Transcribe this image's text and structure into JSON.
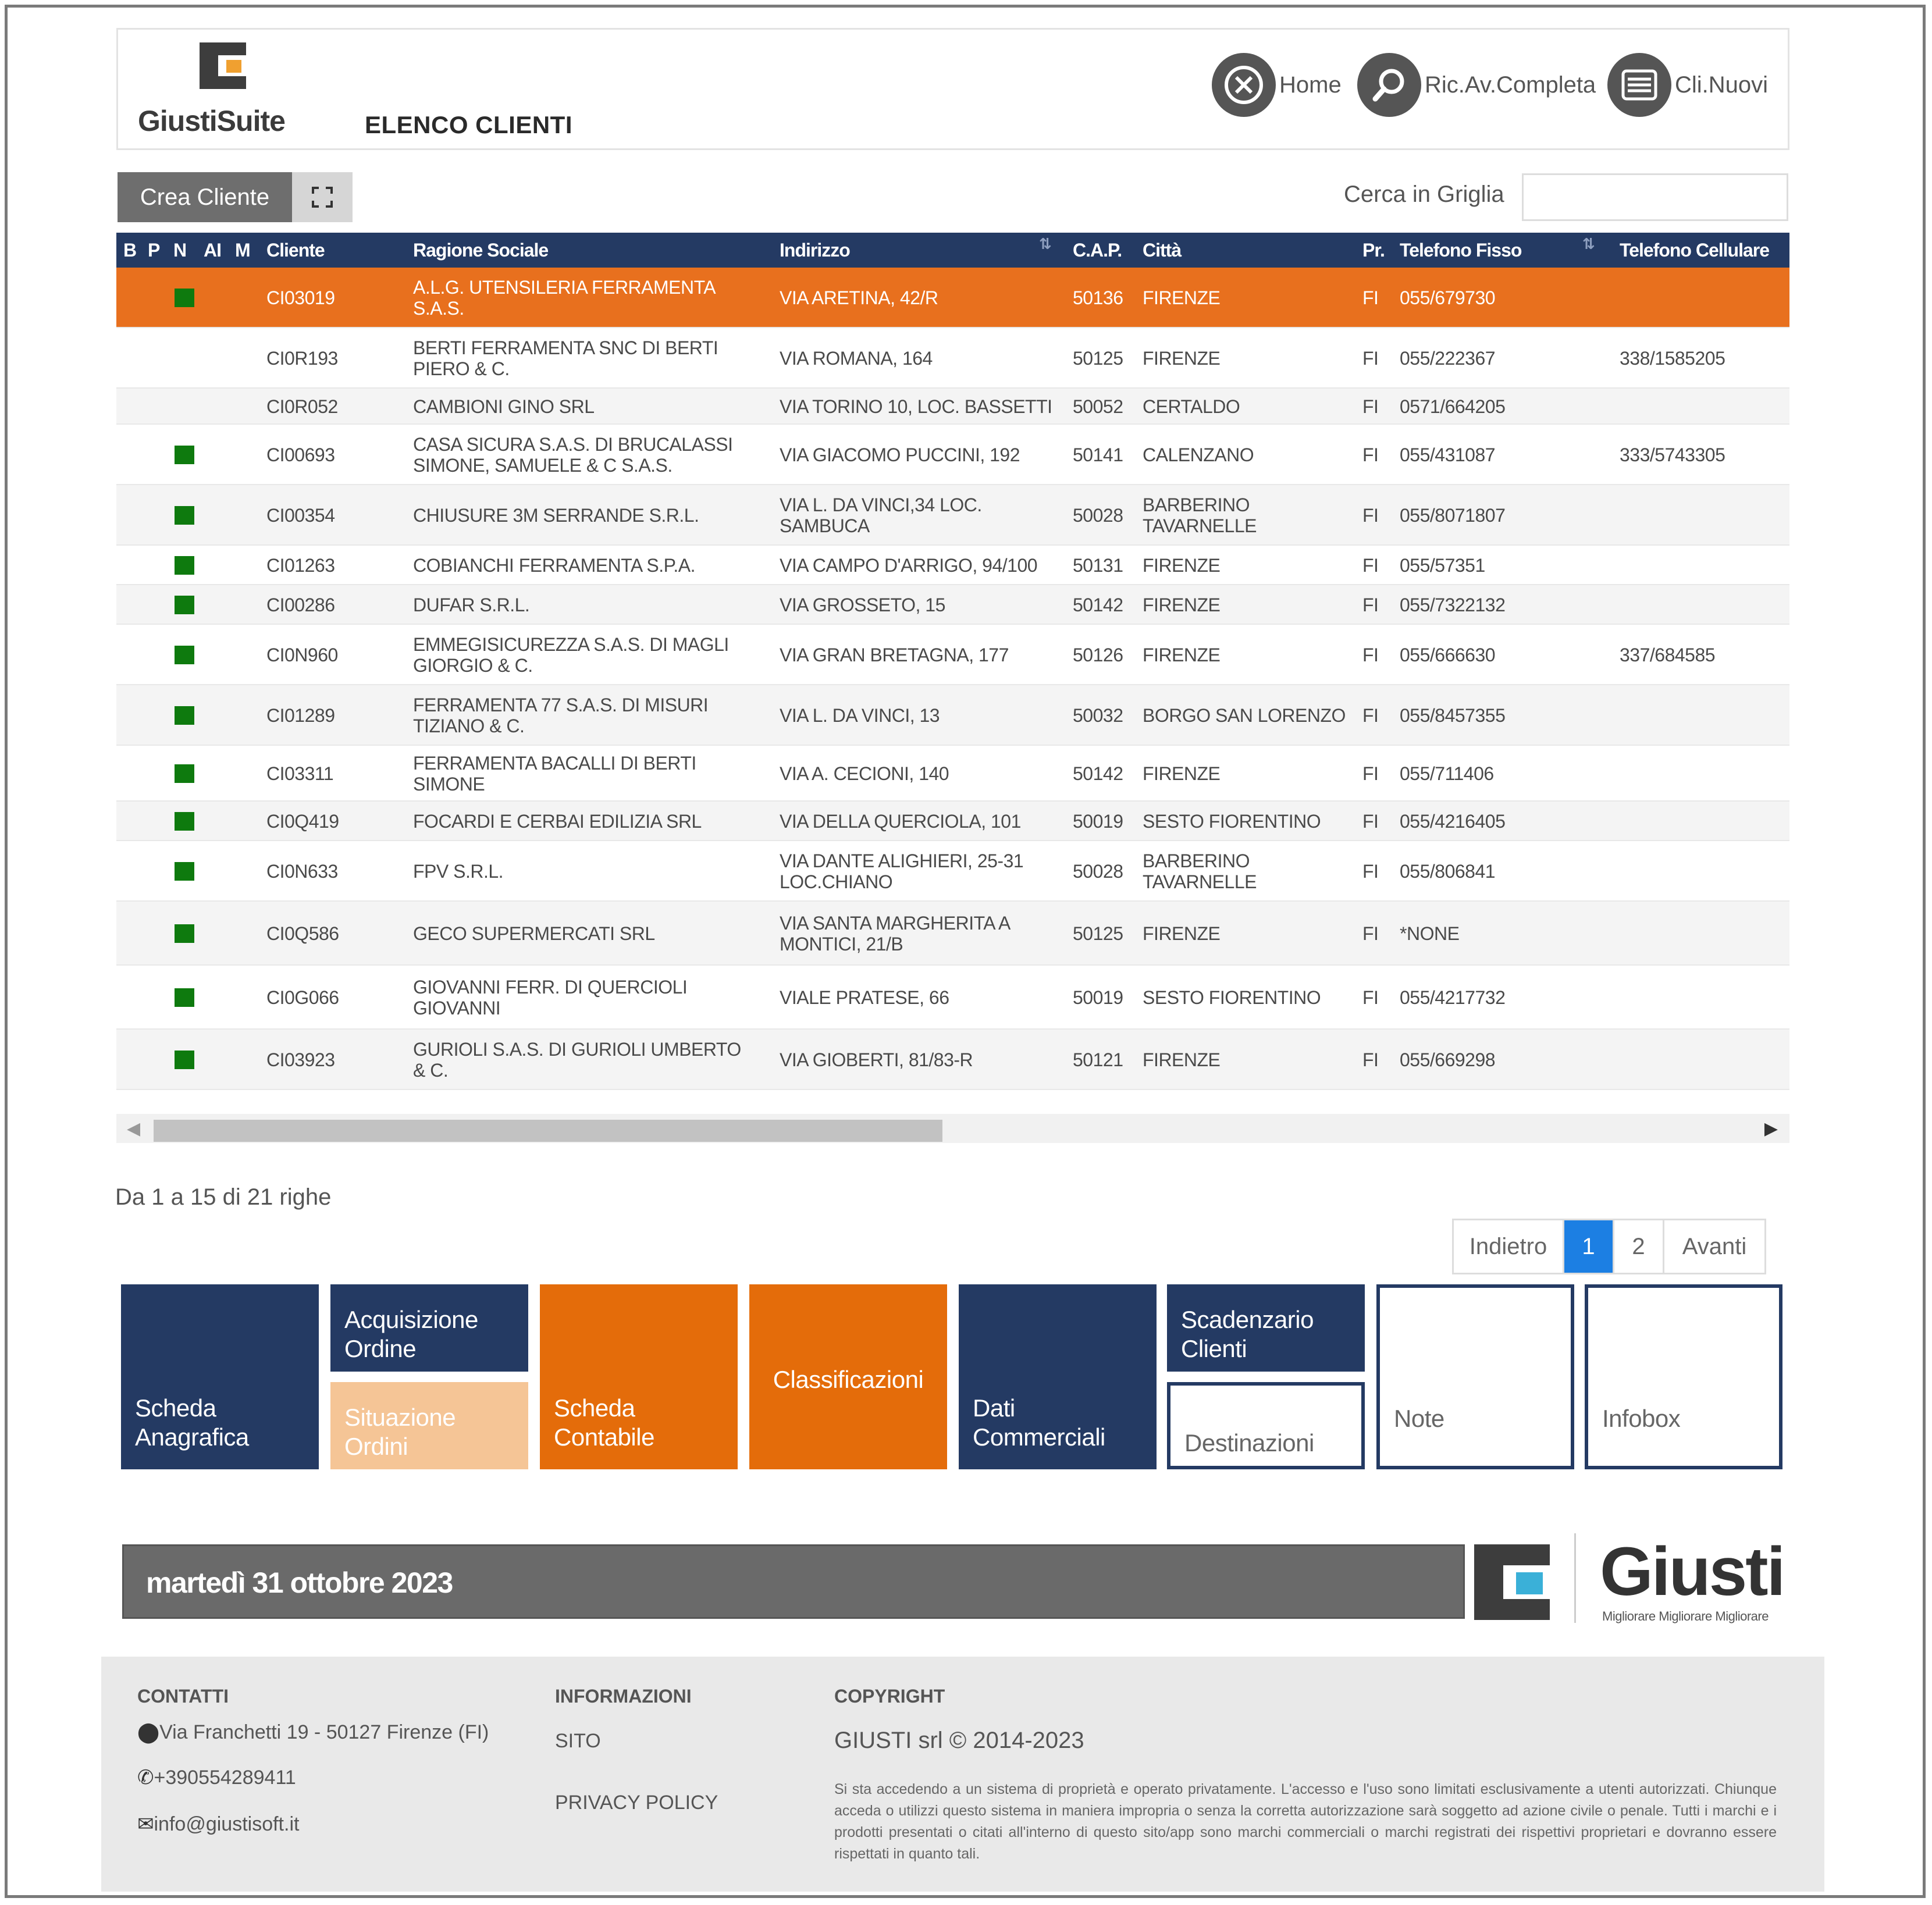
{
  "header": {
    "brand": "GiustiSuite",
    "page_title": "ELENCO CLIENTI",
    "nav": [
      {
        "label": "Home",
        "icon": "close-circle-icon"
      },
      {
        "label": "Ric.Av.Completa",
        "icon": "search-icon"
      },
      {
        "label": "Cli.Nuovi",
        "icon": "list-icon"
      }
    ]
  },
  "toolbar": {
    "create_label": "Crea Cliente",
    "expand_icon": "expand-icon",
    "search_label": "Cerca in Griglia",
    "search_value": ""
  },
  "table": {
    "columns": [
      "B",
      "P",
      "N",
      "AI",
      "M",
      "Cliente",
      "Ragione Sociale",
      "Indirizzo",
      "C.A.P.",
      "Città",
      "Pr.",
      "Telefono Fisso",
      "Telefono Cellulare"
    ],
    "rows": [
      {
        "flag": true,
        "cliente": "CI03019",
        "ragione": "A.L.G. UTENSILERIA FERRAMENTA S.A.S.",
        "indirizzo": "VIA ARETINA, 42/R",
        "cap": "50136",
        "citta": "FIRENZE",
        "pr": "FI",
        "fisso": "055/679730",
        "cell": ""
      },
      {
        "flag": false,
        "cliente": "CI0R193",
        "ragione": "BERTI FERRAMENTA SNC DI BERTI PIERO & C.",
        "indirizzo": "VIA ROMANA, 164",
        "cap": "50125",
        "citta": "FIRENZE",
        "pr": "FI",
        "fisso": "055/222367",
        "cell": "338/1585205"
      },
      {
        "flag": false,
        "cliente": "CI0R052",
        "ragione": "CAMBIONI GINO SRL",
        "indirizzo": "VIA TORINO 10, LOC. BASSETTI",
        "cap": "50052",
        "citta": "CERTALDO",
        "pr": "FI",
        "fisso": "0571/664205",
        "cell": ""
      },
      {
        "flag": true,
        "cliente": "CI00693",
        "ragione": "CASA SICURA S.A.S. DI BRUCALASSI SIMONE, SAMUELE & C S.A.S.",
        "indirizzo": "VIA GIACOMO PUCCINI, 192",
        "cap": "50141",
        "citta": "CALENZANO",
        "pr": "FI",
        "fisso": "055/431087",
        "cell": "333/5743305"
      },
      {
        "flag": true,
        "cliente": "CI00354",
        "ragione": "CHIUSURE 3M SERRANDE S.R.L.",
        "indirizzo": "VIA L. DA VINCI,34 LOC. SAMBUCA",
        "cap": "50028",
        "citta": "BARBERINO TAVARNELLE",
        "pr": "FI",
        "fisso": "055/8071807",
        "cell": ""
      },
      {
        "flag": true,
        "cliente": "CI01263",
        "ragione": "COBIANCHI FERRAMENTA S.P.A.",
        "indirizzo": "VIA CAMPO D'ARRIGO, 94/100",
        "cap": "50131",
        "citta": "FIRENZE",
        "pr": "FI",
        "fisso": "055/57351",
        "cell": ""
      },
      {
        "flag": true,
        "cliente": "CI00286",
        "ragione": "DUFAR S.R.L.",
        "indirizzo": "VIA GROSSETO, 15",
        "cap": "50142",
        "citta": "FIRENZE",
        "pr": "FI",
        "fisso": "055/7322132",
        "cell": ""
      },
      {
        "flag": true,
        "cliente": "CI0N960",
        "ragione": "EMMEGISICUREZZA S.A.S. DI MAGLI GIORGIO & C.",
        "indirizzo": "VIA GRAN BRETAGNA, 177",
        "cap": "50126",
        "citta": "FIRENZE",
        "pr": "FI",
        "fisso": "055/666630",
        "cell": "337/684585"
      },
      {
        "flag": true,
        "cliente": "CI01289",
        "ragione": "FERRAMENTA 77 S.A.S. DI MISURI TIZIANO & C.",
        "indirizzo": "VIA L. DA VINCI, 13",
        "cap": "50032",
        "citta": "BORGO SAN LORENZO",
        "pr": "FI",
        "fisso": "055/8457355",
        "cell": ""
      },
      {
        "flag": true,
        "cliente": "CI03311",
        "ragione": "FERRAMENTA BACALLI DI BERTI SIMONE",
        "indirizzo": "VIA A. CECIONI, 140",
        "cap": "50142",
        "citta": "FIRENZE",
        "pr": "FI",
        "fisso": "055/711406",
        "cell": ""
      },
      {
        "flag": true,
        "cliente": "CI0Q419",
        "ragione": "FOCARDI E CERBAI EDILIZIA SRL",
        "indirizzo": "VIA DELLA QUERCIOLA, 101",
        "cap": "50019",
        "citta": "SESTO FIORENTINO",
        "pr": "FI",
        "fisso": "055/4216405",
        "cell": ""
      },
      {
        "flag": true,
        "cliente": "CI0N633",
        "ragione": "FPV S.R.L.",
        "indirizzo": "VIA DANTE ALIGHIERI, 25-31 LOC.CHIANO",
        "cap": "50028",
        "citta": "BARBERINO TAVARNELLE",
        "pr": "FI",
        "fisso": "055/806841",
        "cell": ""
      },
      {
        "flag": true,
        "cliente": "CI0Q586",
        "ragione": "GECO SUPERMERCATI SRL",
        "indirizzo": "VIA SANTA MARGHERITA A MONTICI, 21/B",
        "cap": "50125",
        "citta": "FIRENZE",
        "pr": "FI",
        "fisso": "*NONE",
        "cell": ""
      },
      {
        "flag": true,
        "cliente": "CI0G066",
        "ragione": "GIOVANNI FERR. DI QUERCIOLI GIOVANNI",
        "indirizzo": "VIALE PRATESE, 66",
        "cap": "50019",
        "citta": "SESTO FIORENTINO",
        "pr": "FI",
        "fisso": "055/4217732",
        "cell": ""
      },
      {
        "flag": true,
        "cliente": "CI03923",
        "ragione": "GURIOLI S.A.S. DI GURIOLI UMBERTO & C.",
        "indirizzo": "VIA GIOBERTI, 81/83-R",
        "cap": "50121",
        "citta": "FIRENZE",
        "pr": "FI",
        "fisso": "055/669298",
        "cell": ""
      }
    ]
  },
  "pagination": {
    "info": "Da 1 a 15 di 21 righe",
    "prev": "Indietro",
    "pages": [
      "1",
      "2"
    ],
    "active_page": "1",
    "next": "Avanti"
  },
  "tiles": {
    "scheda_anagrafica": "Scheda Anagrafica",
    "acquisizione_ordine": "Acquisizione Ordine",
    "situazione_ordini": "Situazione Ordini",
    "scheda_contabile": "Scheda Contabile",
    "classificazioni": "Classificazioni",
    "dati_commerciali": "Dati Commerciali",
    "scadenzario_clienti": "Scadenzario Clienti",
    "destinazioni": "Destinazioni",
    "note": "Note",
    "infobox": "Infobox"
  },
  "datebar": {
    "date": "martedì 31 ottobre 2023"
  },
  "brand_footer": {
    "word": "Giusti",
    "tagline": "Migliorare Migliorare Migliorare"
  },
  "footer": {
    "contatti_title": "CONTATTI",
    "address": "Via Franchetti 19 - 50127 Firenze (FI)",
    "phone": "+390554289411",
    "email": "info@giustisoft.it",
    "info_title": "INFORMAZIONI",
    "sito": "SITO",
    "privacy": "PRIVACY POLICY",
    "copyright_title": "COPYRIGHT",
    "copyright": "GIUSTI srl © 2014-2023",
    "disclaimer": "Si sta accedendo a un sistema di proprietà e operato privatamente. L'accesso e l'uso sono limitati esclusivamente a utenti autorizzati. Chiunque acceda o utilizzi questo sistema in maniera impropria o senza la corretta autorizzazione sarà soggetto ad azione civile o penale. Tutti i marchi e i prodotti presentati o citati all'interno di questo sito/app sono marchi commerciali o marchi registrati dei rispettivi proprietari e dovranno essere rispettati in quanto tali."
  },
  "colors": {
    "navy": "#243a63",
    "orange": "#e46c0a",
    "selected_row": "#e8701e",
    "flag_green": "#0e7a0e",
    "active_page": "#1c7fe3"
  }
}
